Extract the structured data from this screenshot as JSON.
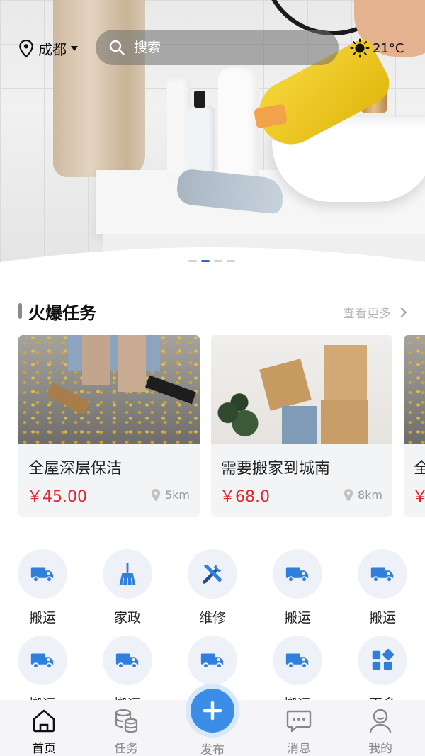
{
  "location": {
    "city": "成都"
  },
  "search": {
    "placeholder": "搜索"
  },
  "weather": {
    "temperature": "21°C"
  },
  "banner": {
    "page_count": 4,
    "active_index": 1
  },
  "hot_tasks": {
    "title": "火爆任务",
    "more_label": "查看更多",
    "items": [
      {
        "title": "全屋深层保洁",
        "price": "￥45.00",
        "distance": "5km"
      },
      {
        "title": "需要搬家到城南",
        "price": "￥68.0",
        "distance": "8km"
      },
      {
        "title": "全",
        "price": "￥",
        "distance": ""
      }
    ]
  },
  "categories": [
    {
      "label": "搬运",
      "icon": "truck-icon"
    },
    {
      "label": "家政",
      "icon": "broom-icon"
    },
    {
      "label": "维修",
      "icon": "tools-icon"
    },
    {
      "label": "搬运",
      "icon": "truck-icon"
    },
    {
      "label": "搬运",
      "icon": "truck-icon"
    },
    {
      "label": "搬运",
      "icon": "truck-icon"
    },
    {
      "label": "搬运",
      "icon": "truck-icon"
    },
    {
      "label": "",
      "icon": "truck-icon"
    },
    {
      "label": "搬运",
      "icon": "truck-icon"
    },
    {
      "label": "更多",
      "icon": "grid-icon"
    }
  ],
  "bottom_nav": [
    {
      "label": "首页",
      "icon": "home-icon",
      "active": true
    },
    {
      "label": "任务",
      "icon": "database-icon",
      "active": false
    },
    {
      "label": "发布",
      "icon": "plus-icon",
      "active": false
    },
    {
      "label": "消息",
      "icon": "message-icon",
      "active": false
    },
    {
      "label": "我的",
      "icon": "user-icon",
      "active": false
    }
  ],
  "colors": {
    "accent": "#3a8ee8",
    "price": "#e0262b",
    "icon_blue": "#2f7fdc"
  }
}
